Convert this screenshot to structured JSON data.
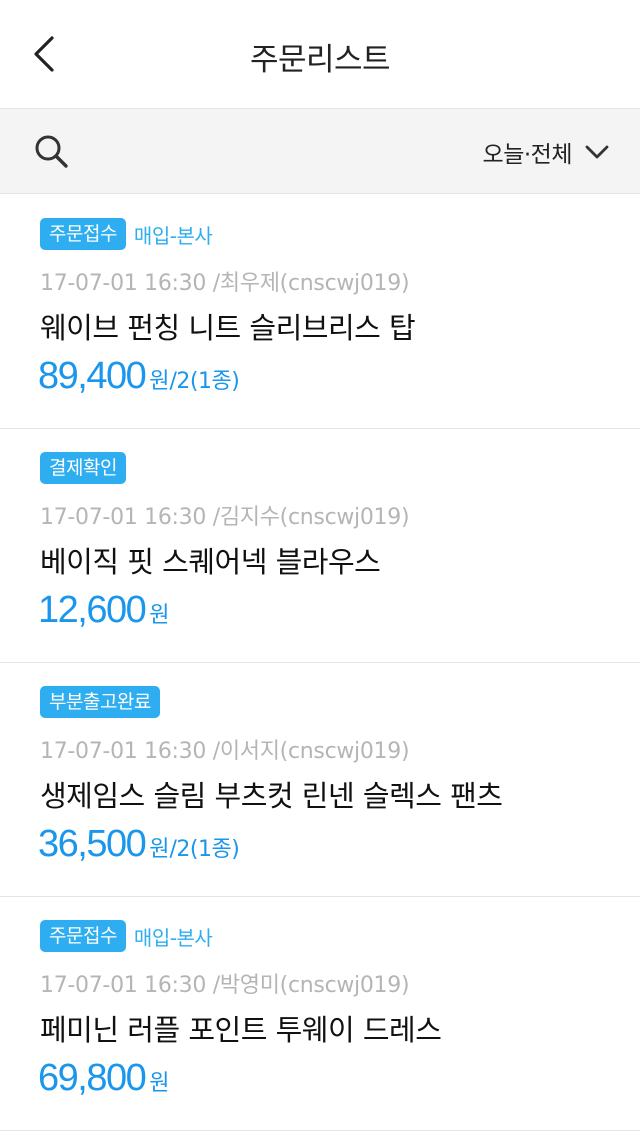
{
  "header": {
    "title": "주문리스트"
  },
  "filter": {
    "label": "오늘·전체"
  },
  "icons": {
    "back": "chevron-left-icon",
    "search": "search-icon",
    "dropdown": "chevron-down-icon"
  },
  "colors": {
    "accent": "#2eaef0",
    "price": "#1a96ec",
    "meta": "#b5b5b5",
    "filter_bg": "#f4f4f4"
  },
  "orders": [
    {
      "status": "주문접수",
      "tag": "매입-본사",
      "meta": "17-07-01 16:30 /최우제(cnscwj019)",
      "name": "웨이브 펀칭 니트 슬리브리스 탑",
      "price": "89,400",
      "unit": "원",
      "qty": "/2(1종)"
    },
    {
      "status": "결제확인",
      "tag": "",
      "meta": "17-07-01 16:30 /김지수(cnscwj019)",
      "name": "베이직 핏 스퀘어넥 블라우스",
      "price": "12,600",
      "unit": "원",
      "qty": ""
    },
    {
      "status": "부분출고완료",
      "tag": "",
      "meta": "17-07-01 16:30 /이서지(cnscwj019)",
      "name": "생제임스 슬림 부츠컷 린넨 슬렉스 팬츠",
      "price": "36,500",
      "unit": "원",
      "qty": "/2(1종)"
    },
    {
      "status": "주문접수",
      "tag": "매입-본사",
      "meta": "17-07-01 16:30 /박영미(cnscwj019)",
      "name": "페미닌 러플 포인트 투웨이 드레스",
      "price": "69,800",
      "unit": "원",
      "qty": ""
    }
  ]
}
